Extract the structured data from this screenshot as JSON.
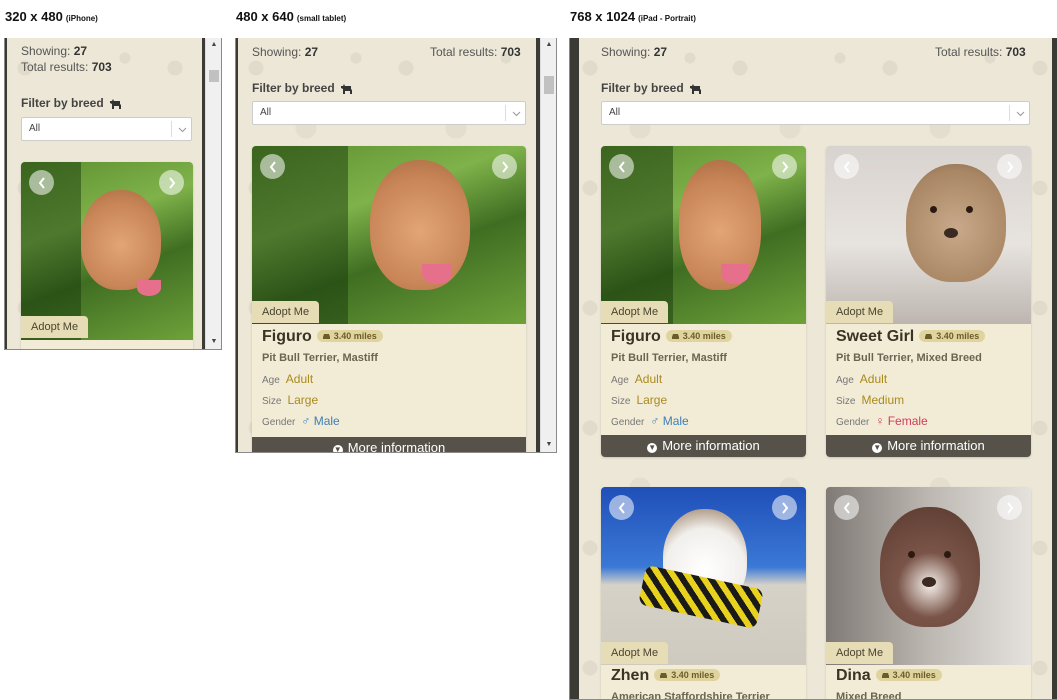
{
  "devices": [
    {
      "size": "320 x 480",
      "name": "(iPhone)"
    },
    {
      "size": "480 x 640",
      "name": "(small tablet)"
    },
    {
      "size": "768 x 1024",
      "name": "(iPad - Portrait)"
    }
  ],
  "results": {
    "showing_label": "Showing:",
    "showing_value": "27",
    "total_label": "Total results:",
    "total_value": "703"
  },
  "filter": {
    "label": "Filter by breed",
    "selected": "All"
  },
  "card_labels": {
    "adopt": "Adopt Me",
    "age": "Age",
    "size": "Size",
    "gender": "Gender",
    "more": "More information"
  },
  "dogs": [
    {
      "name": "Figuro",
      "distance": "3.40 miles",
      "breed": "Pit Bull Terrier, Mastiff",
      "age": "Adult",
      "size": "Large",
      "gender": "Male"
    },
    {
      "name": "Sweet Girl",
      "distance": "3.40 miles",
      "breed": "Pit Bull Terrier, Mixed Breed",
      "age": "Adult",
      "size": "Medium",
      "gender": "Female"
    },
    {
      "name": "Zhen",
      "distance": "3.40 miles",
      "breed": "American Staffordshire Terrier"
    },
    {
      "name": "Dina",
      "distance": "3.40 miles",
      "breed": "Mixed Breed"
    }
  ],
  "colors": {
    "background": "#ece7d6",
    "card": "#f2ecd6",
    "accent": "#a98a1e",
    "male": "#3d7fb8",
    "female": "#d13b5b",
    "more_bar": "#56524a"
  },
  "icons": [
    "dog-icon",
    "car-icon",
    "chevron-left-icon",
    "chevron-right-icon",
    "male-icon",
    "female-icon",
    "info-icon",
    "chevron-down-icon"
  ]
}
